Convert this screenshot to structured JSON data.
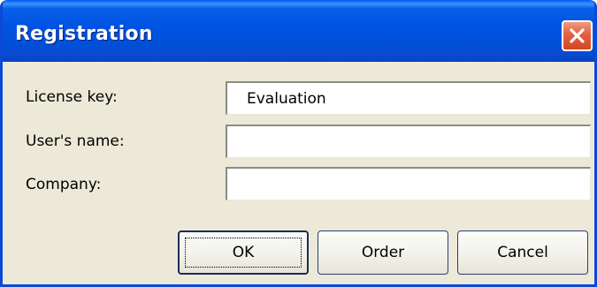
{
  "window": {
    "title": "Registration",
    "close_icon": "close-icon"
  },
  "form": {
    "license_key": {
      "label": "License key:",
      "value": "Evaluation"
    },
    "users_name": {
      "label": "User's name:",
      "value": ""
    },
    "company": {
      "label": "Company:",
      "value": ""
    }
  },
  "buttons": {
    "ok": "OK",
    "order": "Order",
    "cancel": "Cancel"
  },
  "colors": {
    "titlebar": "#0054e3",
    "dialog_background": "#ece9d8",
    "close_button": "#e2603e"
  }
}
